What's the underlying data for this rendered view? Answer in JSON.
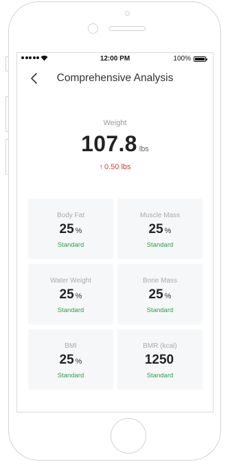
{
  "status_bar": {
    "time": "12:00 PM",
    "battery": "100%"
  },
  "nav": {
    "title": "Comprehensive Analysis"
  },
  "weight": {
    "label": "Weight",
    "value": "107.8",
    "unit": "lbs",
    "change": "0.50 lbs",
    "change_direction": "up",
    "change_color": "#e53935"
  },
  "metrics": [
    {
      "label": "Body Fat",
      "value": "25",
      "unit": "%",
      "status": "Standard"
    },
    {
      "label": "Muscle Mass",
      "value": "25",
      "unit": "%",
      "status": "Standard"
    },
    {
      "label": "Water Weight",
      "value": "25",
      "unit": "%",
      "status": "Standard"
    },
    {
      "label": "Bone Mass",
      "value": "25",
      "unit": "%",
      "status": "Standard"
    },
    {
      "label": "BMI",
      "value": "25",
      "unit": "%",
      "status": "Standard"
    },
    {
      "label": "BMR (kcal)",
      "value": "1250",
      "unit": "",
      "status": "Standard"
    }
  ],
  "colors": {
    "status_green": "#2e9e4f",
    "increase_red": "#e53935"
  }
}
